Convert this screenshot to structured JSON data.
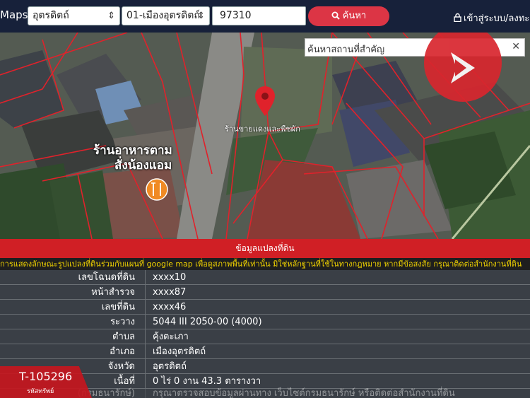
{
  "header": {
    "brand": "Maps",
    "province_select": "อุตรดิตถ์",
    "district_select": "01-เมืองอุตรดิตถ์",
    "postal_code": "97310",
    "search_label": "ค้นหา",
    "login_label": "เข้าสู่ระบบ/ลงทะเบียน"
  },
  "map": {
    "place_search_placeholder": "ค้นหาสถานที่สำคัญ",
    "restaurant_label_line1": "ร้านอาหารตาม",
    "restaurant_label_line2": "สั่งน้องแอม",
    "small_label": "ร้านขายแดงและพืชผัก"
  },
  "panel": {
    "title": "ข้อมูลแปลงที่ดิน",
    "notice": "การแสดงลักษณะรูปแปลงที่ดินร่วมกับแผนที่ google map เพื่อดูสภาพพื้นที่เท่านั้น มิใช่หลักฐานที่ใช้ในทางกฎหมาย หากมีข้อสงสัย กรุณาติดต่อสำนักงานที่ดิน",
    "rows": [
      {
        "label": "เลขโฉนดที่ดิน",
        "value": "xxxx10"
      },
      {
        "label": "หน้าสำรวจ",
        "value": "xxxx87"
      },
      {
        "label": "เลขที่ดิน",
        "value": "xxxx46"
      },
      {
        "label": "ระวาง",
        "value": "5044 III 2050-00 (4000)"
      },
      {
        "label": "ตำบล",
        "value": "คุ้งตะเภา"
      },
      {
        "label": "อำเภอ",
        "value": "เมืองอุตรดิตถ์"
      },
      {
        "label": "จังหวัด",
        "value": "อุตรดิตถ์"
      },
      {
        "label": "เนื้อที่",
        "value": "0 ไร่ 0 งาน 43.3 ตารางวา"
      },
      {
        "label": "(กรมธนารักษ์)",
        "value": "กรุณาตรวจสอบข้อมูลผ่านทาง เว็บไซต์กรมธนารักษ์ หรือติดต่อสำนักงานที่ดิน"
      }
    ]
  },
  "badge": {
    "code": "T-105296",
    "code_label": "รหัสทรัพย์"
  },
  "colors": {
    "topbar": "#17213a",
    "accent_red": "#d01f25",
    "notice_yellow": "#f0d200",
    "parcel_line": "#e0222b"
  },
  "icons": {
    "search": "search-icon",
    "login": "lock-icon",
    "pin": "map-pin-icon",
    "restaurant": "restaurant-icon",
    "close": "close-icon"
  }
}
